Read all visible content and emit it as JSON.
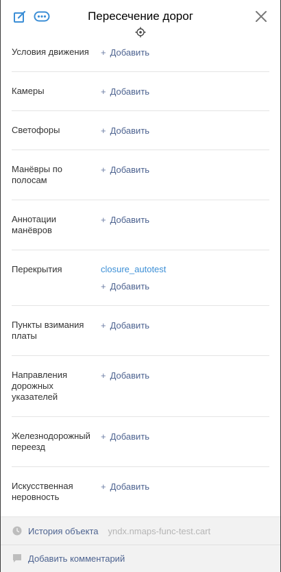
{
  "header": {
    "title": "Пересечение дорог",
    "icons": {
      "edit": "edit-icon",
      "more": "more-options-icon",
      "close": "close-icon",
      "target": "crosshair-target-icon"
    }
  },
  "add_label": "Добавить",
  "rows": [
    {
      "id": "traffic-conditions",
      "label": "Условия движения",
      "add": "Добавить"
    },
    {
      "id": "cameras",
      "label": "Камеры",
      "add": "Добавить"
    },
    {
      "id": "traffic-lights",
      "label": "Светофоры",
      "add": "Добавить"
    },
    {
      "id": "lane-maneuvers",
      "label": "Манёвры по полосам",
      "add": "Добавить"
    },
    {
      "id": "maneuver-annotations",
      "label": "Аннотации манёвров",
      "add": "Добавить"
    },
    {
      "id": "closures",
      "label": "Перекрытия",
      "link": "closure_autotest",
      "add": "Добавить"
    },
    {
      "id": "toll-points",
      "label": "Пункты взимания платы",
      "add": "Добавить"
    },
    {
      "id": "road-sign-directions",
      "label": "Направления дорожных указателей",
      "add": "Добавить"
    },
    {
      "id": "railway-crossing",
      "label": "Железнодорожный переезд",
      "add": "Добавить"
    },
    {
      "id": "speed-bump",
      "label": "Искусственная неровность",
      "add": "Добавить"
    }
  ],
  "footer": {
    "history_label": "История объекта",
    "history_author": "yndx.nmaps-func-test.cart",
    "comment_label": "Добавить комментарий"
  },
  "colors": {
    "accent": "#3b8ed6",
    "link": "#4d6390",
    "object_link": "#3c8fd6"
  }
}
